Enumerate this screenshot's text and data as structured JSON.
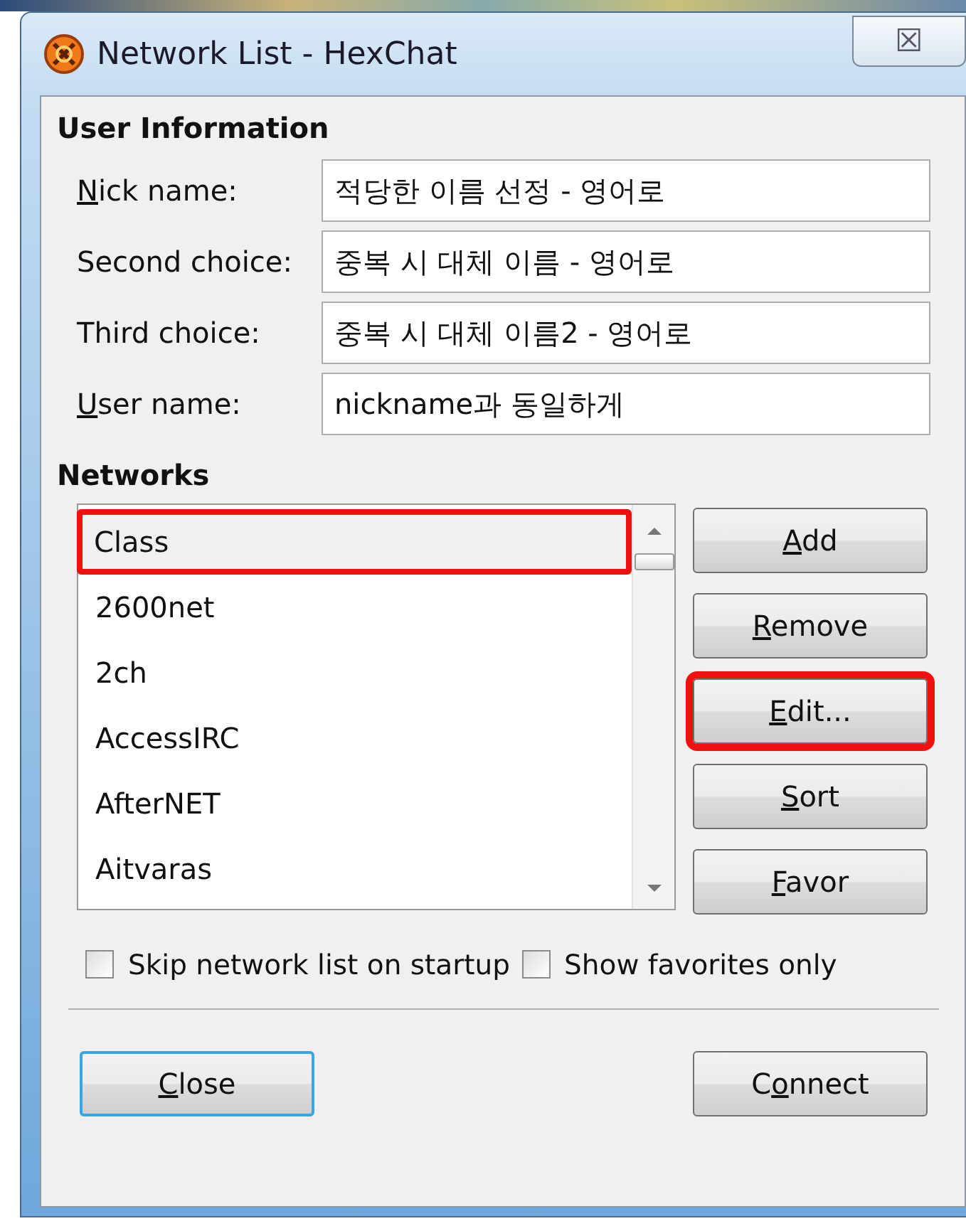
{
  "window": {
    "title": "Network List - HexChat",
    "close_glyph": "☒"
  },
  "user_information": {
    "heading": "User Information",
    "fields": [
      {
        "label": {
          "key": "N",
          "post": "ick name:"
        },
        "value": "적당한 이름 선정 - 영어로"
      },
      {
        "label": {
          "pre": "Second choice:"
        },
        "value": "중복 시 대체 이름 - 영어로"
      },
      {
        "label": {
          "pre": "Third choice:"
        },
        "value": "중복 시 대체 이름2 - 영어로"
      },
      {
        "label": {
          "key": "U",
          "post": "ser name:"
        },
        "value": "nickname과 동일하게"
      }
    ]
  },
  "networks": {
    "heading": "Networks",
    "items": [
      {
        "label": "Class",
        "selected": true,
        "highlighted": true
      },
      {
        "label": "2600net",
        "selected": false,
        "highlighted": false
      },
      {
        "label": "2ch",
        "selected": false,
        "highlighted": false
      },
      {
        "label": "AccessIRC",
        "selected": false,
        "highlighted": false
      },
      {
        "label": "AfterNET",
        "selected": false,
        "highlighted": false
      },
      {
        "label": "Aitvaras",
        "selected": false,
        "highlighted": false
      }
    ],
    "buttons": [
      {
        "label": {
          "key": "A",
          "post": "dd"
        },
        "highlighted": false
      },
      {
        "label": {
          "key": "R",
          "post": "emove"
        },
        "highlighted": false
      },
      {
        "label": {
          "key": "E",
          "post": "dit..."
        },
        "highlighted": true
      },
      {
        "label": {
          "key": "S",
          "post": "ort"
        },
        "highlighted": false
      },
      {
        "label": {
          "key": "F",
          "post": "avor"
        },
        "highlighted": false
      }
    ]
  },
  "options": [
    {
      "label": "Skip network list on startup",
      "checked": false
    },
    {
      "label": "Show favorites only",
      "checked": false
    }
  ],
  "footer_buttons": [
    {
      "label": {
        "key": "C",
        "post": "lose"
      },
      "focused": true
    },
    {
      "label": {
        "pre": "C",
        "key": "o",
        "post": "nnect"
      },
      "focused": false
    }
  ]
}
